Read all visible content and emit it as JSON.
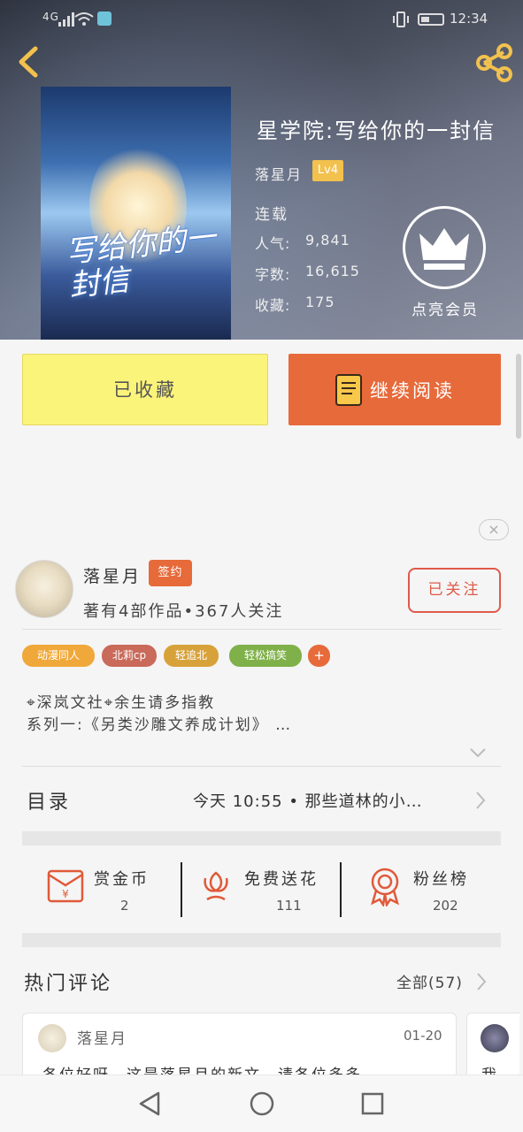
{
  "status_bar": {
    "signal": "4G",
    "time": "12:34"
  },
  "book": {
    "title": "星学院:写给你的一封信",
    "cover_text": "写给你的一封信",
    "author": "落星月",
    "level": "Lv4",
    "status": "连载",
    "stats": [
      {
        "label": "人气:",
        "value": "9,841"
      },
      {
        "label": "字数:",
        "value": "16,615"
      },
      {
        "label": "收藏:",
        "value": "175"
      }
    ],
    "vip_label": "点亮会员"
  },
  "actions": {
    "favorited": "已收藏",
    "continue_reading": "继续阅读"
  },
  "ad": {
    "close": "×"
  },
  "author_panel": {
    "name": "落星月",
    "badge": "签约",
    "info": "著有4部作品•367人关注",
    "follow": "已关注"
  },
  "tags": [
    {
      "label": "动漫同人",
      "color": "#f0a83a"
    },
    {
      "label": "北莉cp",
      "color": "#c96a5a"
    },
    {
      "label": "轻追北",
      "color": "#d8a23a"
    },
    {
      "label": "轻松搞笑",
      "color": "#7fb04a"
    },
    {
      "label": "+",
      "color": "#e76a3a"
    }
  ],
  "description": {
    "line1": "⌖深岚文社⌖余生请多指教",
    "line2": "系列一:《另类沙雕文养成计划》 …"
  },
  "toc": {
    "label": "目录",
    "latest": "今天 10:55 • 那些道林的小…"
  },
  "gifts": [
    {
      "label": "赏金币",
      "value": "2",
      "icon": "coin-envelope-icon"
    },
    {
      "label": "免费送花",
      "value": "111",
      "icon": "flower-icon"
    },
    {
      "label": "粉丝榜",
      "value": "202",
      "icon": "medal-icon"
    }
  ],
  "comments": {
    "title": "热门评论",
    "all": "全部(57)",
    "items": [
      {
        "user": "落星月",
        "date": "01-20",
        "text": "各位好呀，这是落星月的新文，请各位多多"
      },
      {
        "user": "",
        "date": "",
        "text": "我"
      }
    ]
  },
  "colors": {
    "accent": "#e76a3a",
    "favorite_bg": "#fbf47a",
    "follow_red": "#e05a4a",
    "level_gold": "#f2c14e"
  }
}
